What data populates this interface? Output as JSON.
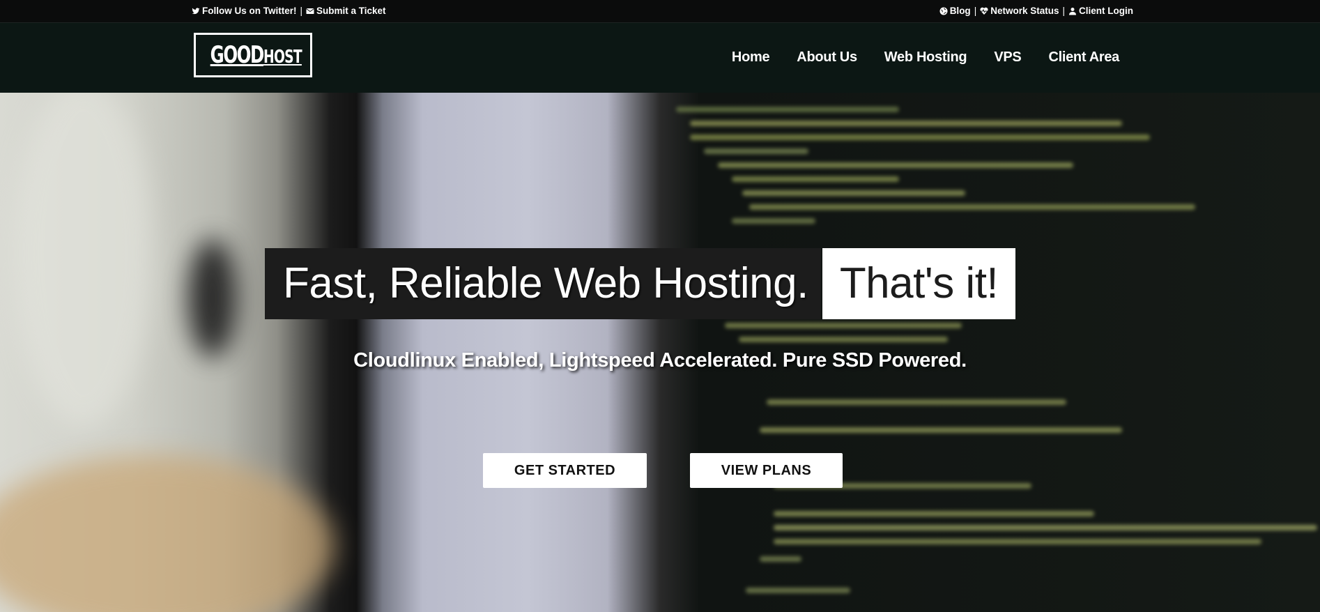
{
  "topbar": {
    "twitter_label": "Follow Us on Twitter!",
    "separator": "|",
    "ticket_label": "Submit a Ticket",
    "blog_label": "Blog",
    "network_label": "Network Status",
    "client_login_label": "Client Login"
  },
  "header": {
    "logo_good": "GOOD",
    "logo_host": "HOST",
    "nav": [
      "Home",
      "About Us",
      "Web Hosting",
      "VPS",
      "Client Area"
    ]
  },
  "hero": {
    "headline_main": "Fast, Reliable Web Hosting.",
    "headline_highlight": "That's it!",
    "subheadline": "Cloudlinux Enabled, Lightspeed Accelerated. Pure SSD Powered.",
    "primary_button": "GET STARTED",
    "secondary_button": "VIEW PLANS"
  },
  "colors": {
    "topbar_bg": "#0b0c0c",
    "header_bg": "#0c1714",
    "headline_dark_bg": "#1c1c1c",
    "button_bg": "#ffffff"
  },
  "icons": {
    "twitter": "twitter-icon",
    "ticket": "envelope-icon",
    "blog": "globe-icon",
    "network": "heartbeat-icon",
    "login": "user-icon"
  }
}
